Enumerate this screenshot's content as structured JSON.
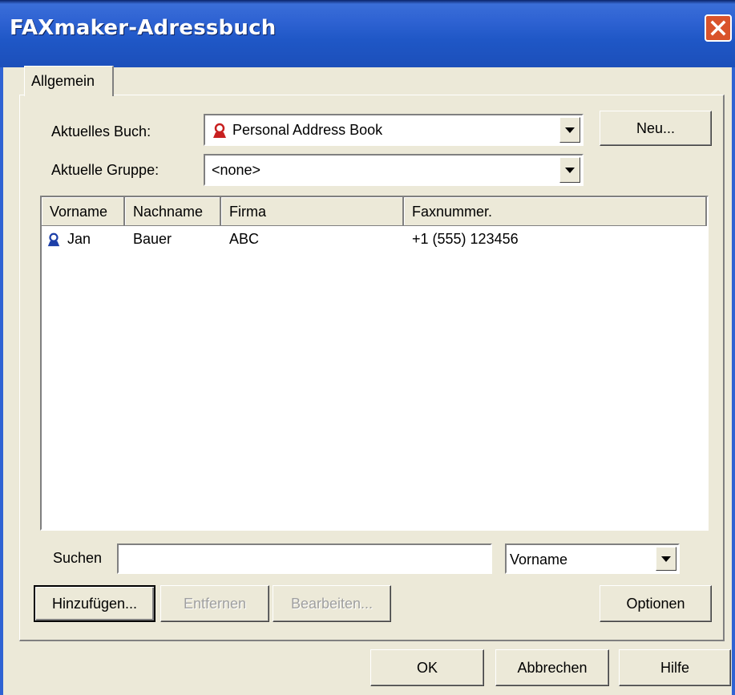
{
  "window": {
    "title": "FAXmaker-Adressbuch"
  },
  "tabs": [
    {
      "label": "Allgemein"
    }
  ],
  "book": {
    "label": "Aktuelles Buch:",
    "value": "Personal Address Book",
    "new_label": "Neu..."
  },
  "group": {
    "label": "Aktuelle Gruppe:",
    "value": "<none>"
  },
  "table": {
    "columns": [
      "Vorname",
      "Nachname",
      "Firma",
      "Faxnummer."
    ],
    "rows": [
      {
        "vorname": "Jan",
        "nachname": "Bauer",
        "firma": "ABC",
        "fax": "+1 (555) 123456"
      }
    ]
  },
  "search": {
    "label": "Suchen",
    "value": "",
    "field": "Vorname"
  },
  "actions": {
    "add": "Hinzufügen...",
    "remove": "Entfernen",
    "edit": "Bearbeiten...",
    "options": "Optionen"
  },
  "footer": {
    "ok": "OK",
    "cancel": "Abbrechen",
    "help": "Hilfe"
  },
  "colors": {
    "titlebar": "#2f63d3",
    "face": "#ece9d8",
    "close": "#d9532b",
    "book_icon": "#c82020",
    "contact_icon": "#1c3fa8"
  },
  "icons": {
    "book": "person-red-icon",
    "contact": "person-blue-icon",
    "close": "close-icon",
    "dropdown": "chevron-down-icon"
  }
}
